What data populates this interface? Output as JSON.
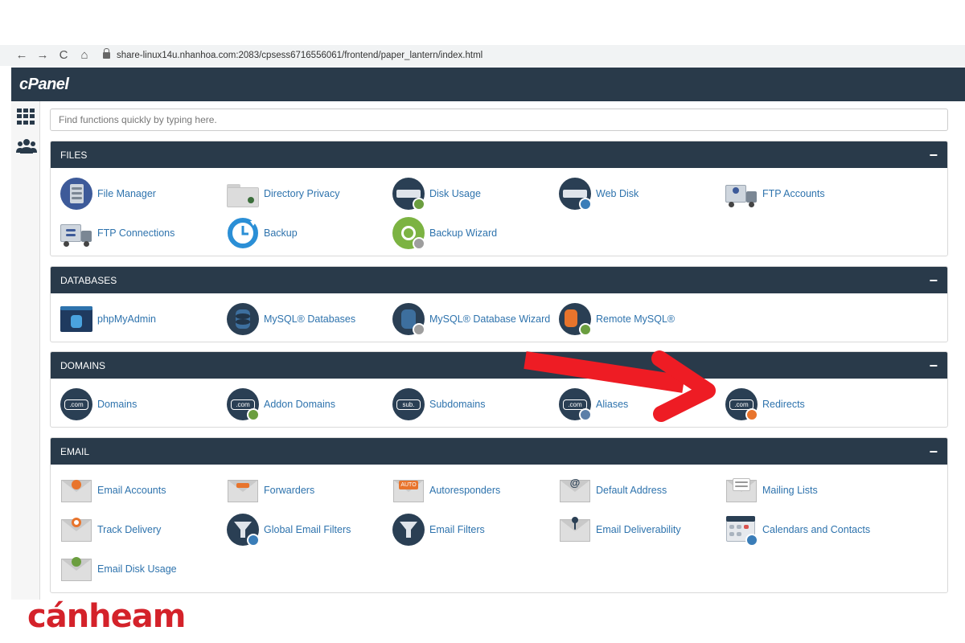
{
  "browser": {
    "back": "←",
    "forward": "→",
    "reload": "C",
    "home": "⌂",
    "url": "share-linux14u.nhanhoa.com:2083/cpsess6716556061/frontend/paper_lantern/index.html"
  },
  "header": {
    "logo": "cPanel"
  },
  "search": {
    "placeholder": "Find functions quickly by typing here."
  },
  "sections": {
    "files": {
      "title": "FILES",
      "items": [
        "File Manager",
        "Directory Privacy",
        "Disk Usage",
        "Web Disk",
        "FTP Accounts",
        "FTP Connections",
        "Backup",
        "Backup Wizard"
      ]
    },
    "databases": {
      "title": "DATABASES",
      "items": [
        "phpMyAdmin",
        "MySQL® Databases",
        "MySQL® Database Wizard",
        "Remote MySQL®"
      ]
    },
    "domains": {
      "title": "DOMAINS",
      "items": [
        "Domains",
        "Addon Domains",
        "Subdomains",
        "Aliases",
        "Redirects"
      ]
    },
    "email": {
      "title": "EMAIL",
      "items": [
        "Email Accounts",
        "Forwarders",
        "Autoresponders",
        "Default Address",
        "Mailing Lists",
        "Track Delivery",
        "Global Email Filters",
        "Email Filters",
        "Email Deliverability",
        "Calendars and Contacts",
        "Email Disk Usage"
      ]
    }
  },
  "collapse_symbol": "−",
  "icon_text": {
    "com": ".com",
    "sub": "sub.",
    "auto": "AUTO",
    "at": "@"
  },
  "colors": {
    "header": "#293a4a",
    "link": "#2e73ad",
    "arrow": "#ee1c24",
    "brand": "#d4222a"
  },
  "brand": {
    "text": "cánheam"
  }
}
